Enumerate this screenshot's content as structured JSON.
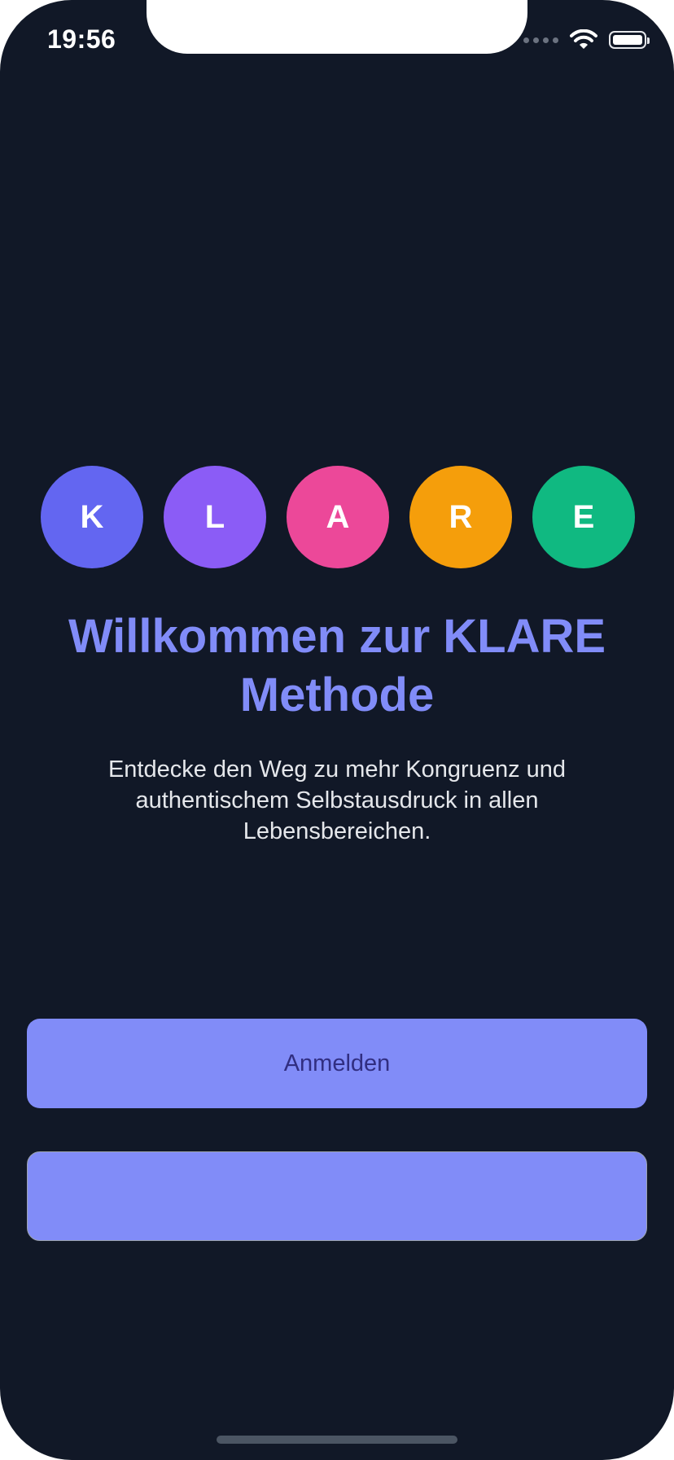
{
  "status_bar": {
    "time": "19:56",
    "icons": [
      "signal-dots-icon",
      "wifi-icon",
      "battery-icon"
    ]
  },
  "logo_circles": [
    {
      "letter": "K",
      "color": "#6366f1"
    },
    {
      "letter": "L",
      "color": "#8b5cf6"
    },
    {
      "letter": "A",
      "color": "#ec4899"
    },
    {
      "letter": "R",
      "color": "#f59e0b"
    },
    {
      "letter": "E",
      "color": "#10b981"
    }
  ],
  "welcome": {
    "title": "Willkommen zur KLARE Methode",
    "subtitle": "Entdecke den Weg zu mehr Kongruenz und authentischem Selbstausdruck in allen Lebensbereichen."
  },
  "actions": {
    "login_label": "Anmelden",
    "secondary_label": ""
  },
  "colors": {
    "background": "#111827",
    "accent": "#818cf8",
    "button_text": "#312e81"
  }
}
